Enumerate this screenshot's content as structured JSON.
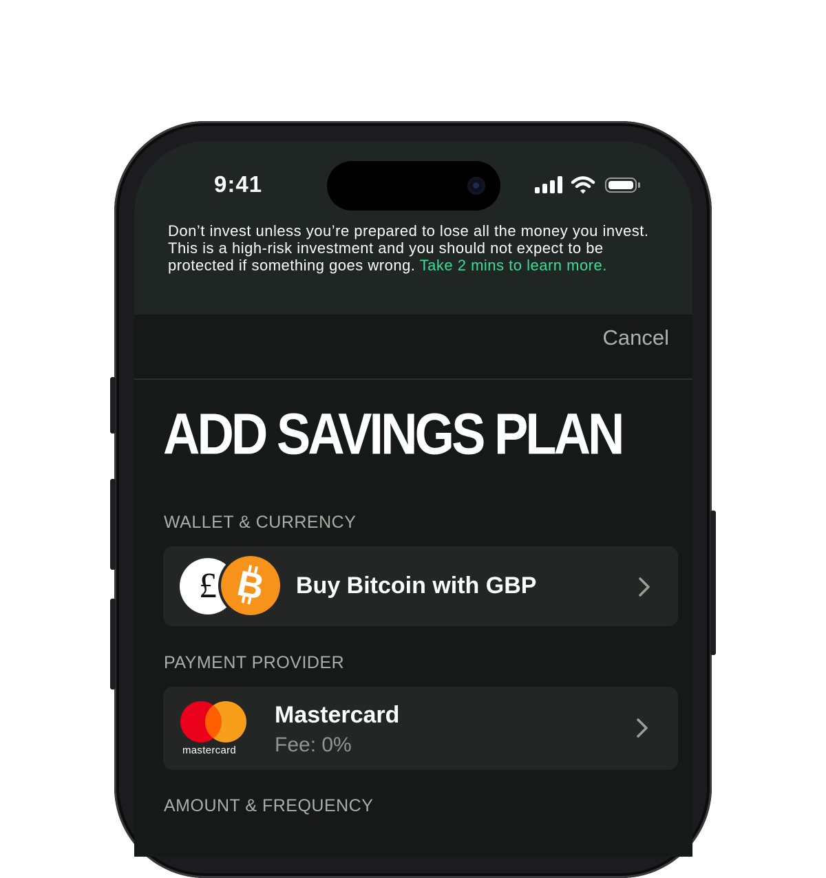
{
  "status_bar": {
    "time": "9:41",
    "icons": [
      "signal-icon",
      "wifi-icon",
      "battery-icon"
    ]
  },
  "risk_warning": {
    "text": "Don’t invest unless you’re prepared to lose all the money you invest. This is a high-risk investment and you should not expect to be protected if something goes wrong. ",
    "link_text": "Take 2 mins to learn more."
  },
  "nav": {
    "cancel_label": "Cancel"
  },
  "page_title": "ADD SAVINGS PLAN",
  "sections": {
    "wallet": {
      "label": "WALLET & CURRENCY",
      "item_title": "Buy Bitcoin with GBP",
      "icons": [
        "pound-coin-icon",
        "bitcoin-coin-icon",
        "chevron-right-icon"
      ]
    },
    "payment": {
      "label": "PAYMENT PROVIDER",
      "item_title": "Mastercard",
      "item_subtitle": "Fee: 0%",
      "logo_text": "mastercard",
      "icons": [
        "mastercard-logo-icon",
        "chevron-right-icon"
      ]
    },
    "amount": {
      "label": "AMOUNT & FREQUENCY"
    }
  },
  "colors": {
    "accent_link": "#3ddc97",
    "background": "#161918",
    "card": "#242625",
    "bitcoin_orange": "#f7931a",
    "mastercard_red": "#eb001b",
    "mastercard_yellow": "#f79e1b"
  }
}
